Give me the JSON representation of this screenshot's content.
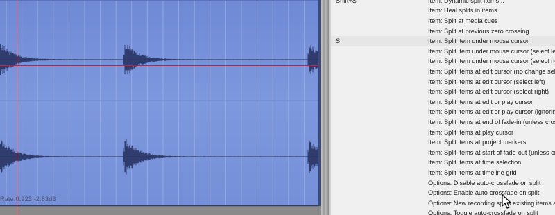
{
  "waveform_item": {
    "info": "Rate:0.923 -2.83dB"
  },
  "actions": {
    "rows": [
      {
        "shortcut": "Shift+S",
        "desc": "Item: Dynamic split items..."
      },
      {
        "shortcut": "",
        "desc": "Item: Heal splits in items"
      },
      {
        "shortcut": "",
        "desc": "Item: Split at media cues"
      },
      {
        "shortcut": "",
        "desc": "Item: Split at previous zero crossing"
      },
      {
        "shortcut": "S",
        "desc": "Item: Split item under mouse cursor",
        "selected": true
      },
      {
        "shortcut": "",
        "desc": "Item: Split item under mouse cursor (select left)"
      },
      {
        "shortcut": "",
        "desc": "Item: Split item under mouse cursor (select right)"
      },
      {
        "shortcut": "",
        "desc": "Item: Split items at edit cursor (no change selection)"
      },
      {
        "shortcut": "",
        "desc": "Item: Split items at edit cursor (select left)"
      },
      {
        "shortcut": "",
        "desc": "Item: Split items at edit cursor (select right)"
      },
      {
        "shortcut": "",
        "desc": "Item: Split items at edit or play cursor"
      },
      {
        "shortcut": "",
        "desc": "Item: Split items at edit or play cursor (ignoring grouping)"
      },
      {
        "shortcut": "",
        "desc": "Item: Split items at end of fade-in (unless crossfade)"
      },
      {
        "shortcut": "",
        "desc": "Item: Split items at play cursor"
      },
      {
        "shortcut": "",
        "desc": "Item: Split items at project markers"
      },
      {
        "shortcut": "",
        "desc": "Item: Split items at start of fade-out (unless crossfade)"
      },
      {
        "shortcut": "",
        "desc": "Item: Split items at time selection"
      },
      {
        "shortcut": "",
        "desc": "Item: Split items at timeline grid"
      },
      {
        "shortcut": "",
        "desc": "Options: Disable auto-crossfade on split"
      },
      {
        "shortcut": "",
        "desc": "Options: Enable auto-crossfade on split"
      },
      {
        "shortcut": "",
        "desc": "Options: New recording splits existing items and creates new takes"
      },
      {
        "shortcut": "",
        "desc": "Options: Toggle auto-crossfade on split"
      }
    ]
  },
  "colors": {
    "item_fill": "#7b95da",
    "waveform": "#2a3560",
    "edit_cursor": "#c8203a",
    "selection_row": "#e6e6e6"
  }
}
